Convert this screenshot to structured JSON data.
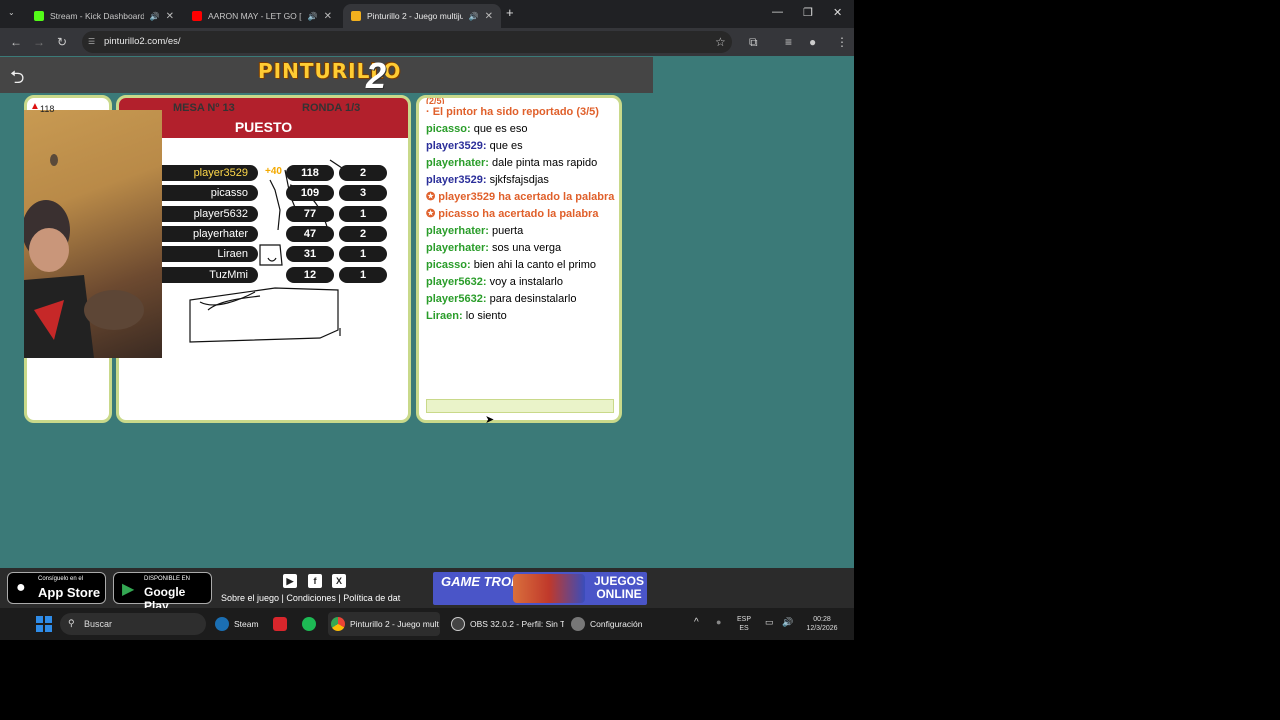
{
  "browser": {
    "tabs": [
      {
        "title": "Stream - Kick Dashboard",
        "audio": "🔊",
        "favicon_color": "#53fc18"
      },
      {
        "title": "AARON MAY - LET GO [Pro",
        "audio": "🔊",
        "favicon_color": "#ff0000"
      },
      {
        "title": "Pinturillo 2 - Juego multijug",
        "audio": "🔊",
        "favicon_color": "#f2b01e"
      }
    ],
    "url": "pinturillo2.com/es/",
    "new_tab": "+"
  },
  "game": {
    "logo_text": "PINTURILLO",
    "logo_num": "2",
    "table": "MESA Nº 13",
    "round": "RONDA 1/3",
    "section": "PUESTO",
    "own_score_peek": "118",
    "bonus": "+40",
    "players": [
      {
        "name": "player3529",
        "score": "118",
        "count": "2",
        "me": true
      },
      {
        "name": "picasso",
        "score": "109",
        "count": "3",
        "me": false
      },
      {
        "name": "player5632",
        "score": "77",
        "count": "1",
        "me": false
      },
      {
        "name": "playerhater",
        "score": "47",
        "count": "2",
        "me": false
      },
      {
        "name": "Liraen",
        "score": "31",
        "count": "1",
        "me": false
      },
      {
        "name": "TuzMmi",
        "score": "12",
        "count": "1",
        "me": false
      }
    ]
  },
  "chat": {
    "partial_top": "(2/5)",
    "messages": [
      {
        "type": "sys",
        "text": "· El pintor ha sido reportado (3/5)"
      },
      {
        "type": "user",
        "user": "picasso:",
        "text": " que es eso",
        "blue": false
      },
      {
        "type": "user",
        "user": "player3529:",
        "text": " que es",
        "blue": true
      },
      {
        "type": "user",
        "user": "playerhater:",
        "text": " dale pinta mas rapido",
        "blue": false
      },
      {
        "type": "user",
        "user": "player3529:",
        "text": " sjkfsfajsdjas",
        "blue": true
      },
      {
        "type": "sys",
        "text": "✪ player3529 ha acertado la palabra"
      },
      {
        "type": "sys",
        "text": "✪ picasso ha acertado la palabra"
      },
      {
        "type": "user",
        "user": "playerhater:",
        "text": " puerta",
        "blue": false
      },
      {
        "type": "user",
        "user": "playerhater:",
        "text": " sos una verga",
        "blue": false
      },
      {
        "type": "user",
        "user": "picasso:",
        "text": " bien ahi la canto el primo",
        "blue": false
      },
      {
        "type": "user",
        "user": "player5632:",
        "text": " voy a instalarlo",
        "blue": false
      },
      {
        "type": "user",
        "user": "player5632:",
        "text": " para desinstalarlo",
        "blue": false
      },
      {
        "type": "user",
        "user": "Liraen:",
        "text": " lo siento",
        "blue": false
      }
    ]
  },
  "footer": {
    "appstore_small": "Consíguelo en el",
    "appstore_big": "App Store",
    "googleplay_small": "DISPONIBLE EN",
    "googleplay_big": "Google Play",
    "links": "Sobre el juego | Condiciones | Política de dat",
    "banner_left": "GAME TRONIA",
    "banner_right": "JUEGOS ONLINE"
  },
  "taskbar": {
    "search": "Buscar",
    "apps": [
      {
        "label": "Steam",
        "color": "#1b6fb3"
      },
      {
        "label": "",
        "color": "#d8262c"
      },
      {
        "label": "",
        "color": "#1db954"
      },
      {
        "label": "Pinturillo 2 - Juego mult",
        "color": "#e8b030"
      },
      {
        "label": "OBS 32.0.2 - Perfil: Sin T",
        "color": "#555"
      },
      {
        "label": "Configuración",
        "color": "#777"
      }
    ],
    "lang": "ESP",
    "lang2": "ES",
    "time": "00:28",
    "date": "12/3/2026"
  },
  "colors": {
    "page_bg": "#3b7a78",
    "header_red": "#b2202c",
    "panel_border": "#c9d98a"
  }
}
